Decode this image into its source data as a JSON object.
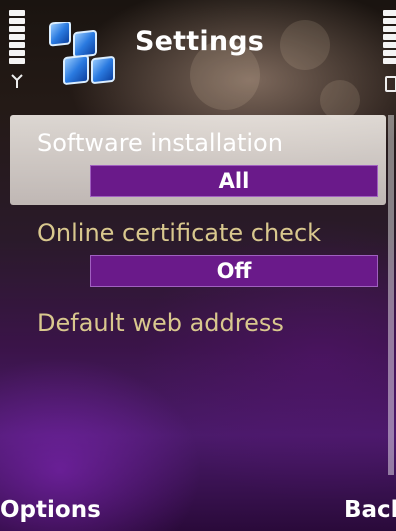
{
  "status_bar": {
    "signal_icon": "antenna-icon",
    "battery_icon": "battery-icon"
  },
  "header": {
    "title": "Settings",
    "icon": "settings-app-icon"
  },
  "list": {
    "items": [
      {
        "label": "Software installation",
        "value": "All",
        "selected": true
      },
      {
        "label": "Online certificate check",
        "value": "Off",
        "selected": false
      },
      {
        "label": "Default web address",
        "value": "",
        "selected": false
      }
    ]
  },
  "softkeys": {
    "left": "Options",
    "right": "Back"
  },
  "colors": {
    "selected_value_bg": "#6a1a8a",
    "unselected_label": "#d9c88e",
    "title": "#ffffff"
  }
}
